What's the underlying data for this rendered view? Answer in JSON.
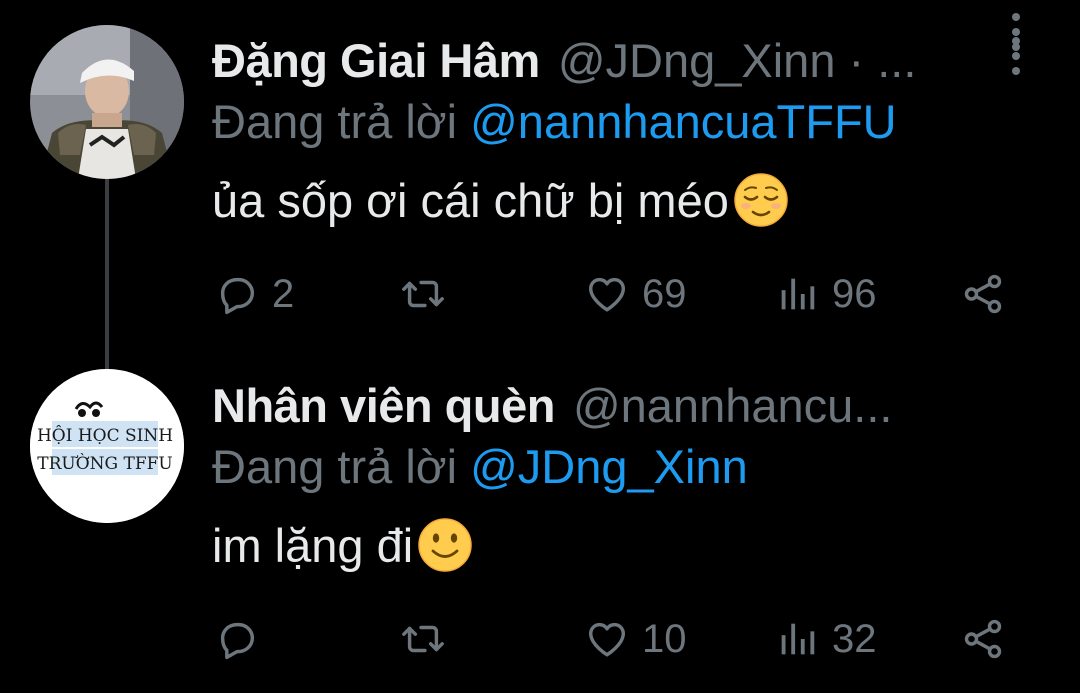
{
  "tweets": [
    {
      "name": "Đặng Giai Hâm",
      "handle": "@JDng_Xinn · ...",
      "reply_prefix": "Đang trả lời ",
      "reply_mention": "@nannhancuaTFFU",
      "text": "ủa sốp ơi cái chữ bị méo",
      "emoji": "relieved-face",
      "replies": "2",
      "retweets": "",
      "likes": "69",
      "views": "96"
    },
    {
      "name": "Nhân viên quèn",
      "handle": "@nannhancu...",
      "reply_prefix": "Đang trả lời ",
      "reply_mention": "@JDng_Xinn",
      "text": "im lặng đi",
      "emoji": "slightly-smiling-face",
      "replies": "",
      "retweets": "",
      "likes": "10",
      "views": "32",
      "avatar_text_line1": "HỘI HỌC SINH",
      "avatar_text_line2": "TRƯỜNG TFFU"
    }
  ],
  "colors": {
    "background": "#000000",
    "name": "#e7e9ea",
    "secondary": "#6e767d",
    "mention": "#1d9bf0"
  }
}
